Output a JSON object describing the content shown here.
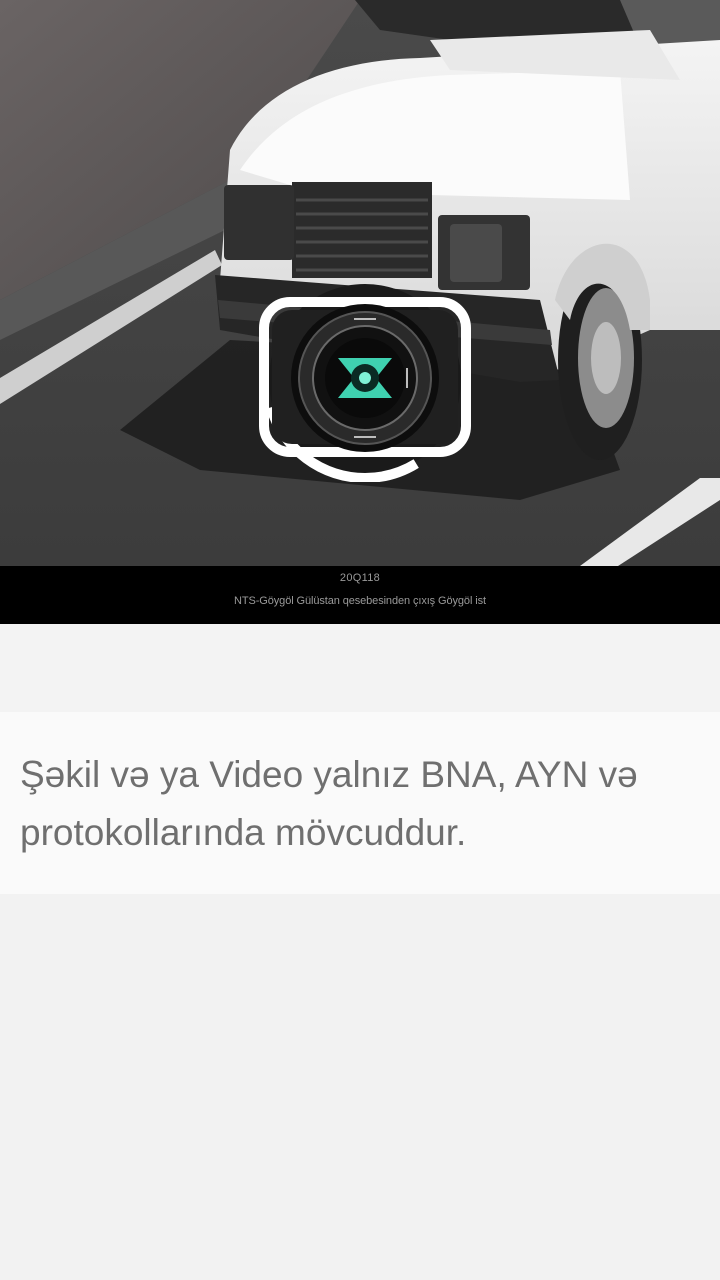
{
  "photo": {
    "caption_id": "20Q118",
    "caption_location": "NTS-Göygöl Gülüstan qesebesinden çıxış Göygöl ist"
  },
  "camera_icon": "camera-icon",
  "notice": {
    "text": "Şəkil və ya Video yalnız BNA, AYN və\nprotokollarında mövcuddur."
  },
  "colors": {
    "caption_bg": "#000000",
    "card_bg": "#fafafa",
    "page_bg": "#f3f3f3",
    "text": "#6f6f6f",
    "lens_accent": "#3fd1b0"
  }
}
